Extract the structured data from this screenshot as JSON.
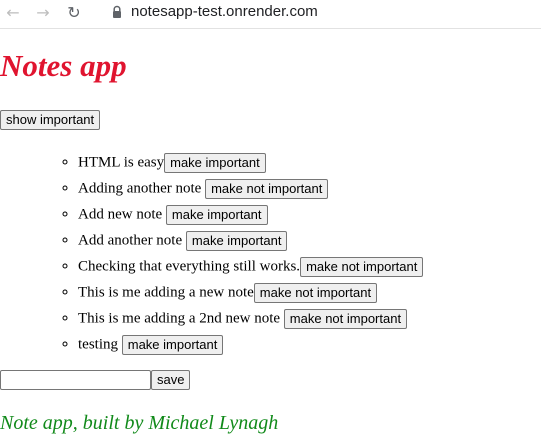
{
  "browser": {
    "url": "notesapp-test.onrender.com",
    "back_glyph": "←",
    "forward_glyph": "→",
    "reload_glyph": "↻"
  },
  "page": {
    "title": "Notes app",
    "title_color": "#e0142f",
    "show_button_label": "show important",
    "notes": [
      {
        "content": "HTML is easy",
        "button_label": "make important"
      },
      {
        "content": "Adding another note",
        "button_label": "make not important"
      },
      {
        "content": "Add new note",
        "button_label": "make important"
      },
      {
        "content": "Add another note",
        "button_label": "make important"
      },
      {
        "content": "Checking that everything still works.",
        "button_label": "make not important"
      },
      {
        "content": "This is me adding a new note",
        "button_label": "make not important"
      },
      {
        "content": "This is me adding a 2nd new note",
        "button_label": "make not important"
      },
      {
        "content": "testing",
        "button_label": "make important"
      }
    ],
    "new_note_value": "",
    "save_label": "save",
    "footer": "Note app, built by Michael Lynagh",
    "footer_color": "#118a1a"
  }
}
